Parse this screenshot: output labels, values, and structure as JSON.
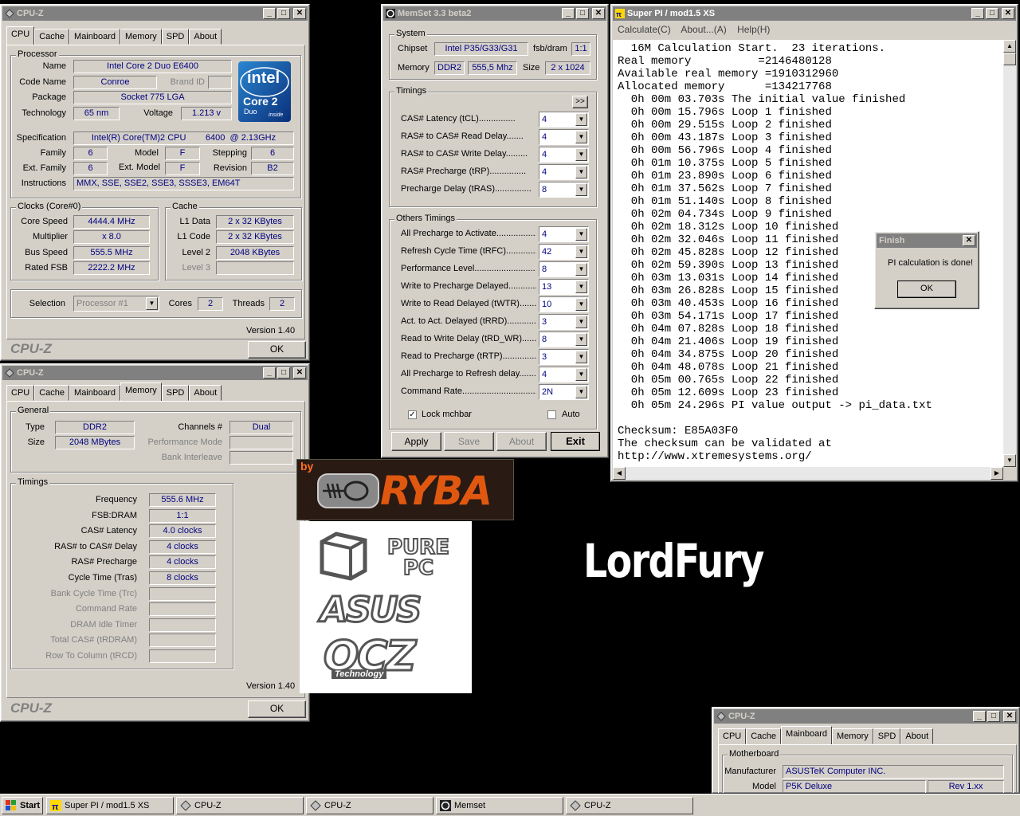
{
  "cpuz1": {
    "title": "CPU-Z",
    "tabs": [
      "CPU",
      "Cache",
      "Mainboard",
      "Memory",
      "SPD",
      "About"
    ],
    "processor_group": "Processor",
    "name_label": "Name",
    "name": "Intel Core 2 Duo E6400",
    "codename_label": "Code Name",
    "codename": "Conroe",
    "brandid_label": "Brand ID",
    "package_label": "Package",
    "package": "Socket 775 LGA",
    "technology_label": "Technology",
    "technology": "65 nm",
    "voltage_label": "Voltage",
    "voltage": "1.213 v",
    "spec_label": "Specification",
    "spec": "Intel(R) Core(TM)2 CPU        6400  @ 2.13GHz",
    "family_label": "Family",
    "family": "6",
    "model_label": "Model",
    "model": "F",
    "stepping_label": "Stepping",
    "stepping": "6",
    "extfamily_label": "Ext. Family",
    "extfamily": "6",
    "extmodel_label": "Ext. Model",
    "extmodel": "F",
    "revision_label": "Revision",
    "revision": "B2",
    "instructions_label": "Instructions",
    "instructions": "MMX, SSE, SSE2, SSE3, SSSE3, EM64T",
    "logo_intel": "intel",
    "logo_core2": "Core 2",
    "logo_duo": "Duo",
    "logo_inside": "inside",
    "clocks_group": "Clocks (Core#0)",
    "corespeed_label": "Core Speed",
    "corespeed": "4444.4 MHz",
    "multiplier_label": "Multiplier",
    "multiplier": "x 8.0",
    "busspeed_label": "Bus Speed",
    "busspeed": "555.5 MHz",
    "ratedfsb_label": "Rated FSB",
    "ratedfsb": "2222.2 MHz",
    "cache_group": "Cache",
    "l1data_label": "L1 Data",
    "l1data": "2 x 32 KBytes",
    "l1code_label": "L1 Code",
    "l1code": "2 x 32 KBytes",
    "level2_label": "Level 2",
    "level2": "2048 KBytes",
    "level3_label": "Level 3",
    "selection_label": "Selection",
    "selection": "Processor #1",
    "cores_label": "Cores",
    "cores": "2",
    "threads_label": "Threads",
    "threads": "2",
    "version": "Version 1.40",
    "brand": "CPU-Z",
    "ok": "OK"
  },
  "cpuz2": {
    "title": "CPU-Z",
    "tabs": [
      "CPU",
      "Cache",
      "Mainboard",
      "Memory",
      "SPD",
      "About"
    ],
    "general_group": "General",
    "type_label": "Type",
    "type": "DDR2",
    "channels_label": "Channels #",
    "channels": "Dual",
    "size_label": "Size",
    "size": "2048 MBytes",
    "perfmode_label": "Performance Mode",
    "bankinter_label": "Bank Interleave",
    "timings_group": "Timings",
    "rows": [
      {
        "label": "Frequency",
        "value": "555.6 MHz",
        "dis": false
      },
      {
        "label": "FSB:DRAM",
        "value": "1:1",
        "dis": false
      },
      {
        "label": "CAS# Latency",
        "value": "4.0 clocks",
        "dis": false
      },
      {
        "label": "RAS# to CAS# Delay",
        "value": "4 clocks",
        "dis": false
      },
      {
        "label": "RAS# Precharge",
        "value": "4 clocks",
        "dis": false
      },
      {
        "label": "Cycle Time (Tras)",
        "value": "8 clocks",
        "dis": false
      },
      {
        "label": "Bank Cycle Time (Trc)",
        "value": "",
        "dis": true
      },
      {
        "label": "Command Rate",
        "value": "",
        "dis": true
      },
      {
        "label": "DRAM Idle Timer",
        "value": "",
        "dis": true
      },
      {
        "label": "Total CAS# (tRDRAM)",
        "value": "",
        "dis": true
      },
      {
        "label": "Row To Column (tRCD)",
        "value": "",
        "dis": true
      }
    ],
    "version": "Version 1.40",
    "brand": "CPU-Z",
    "ok": "OK"
  },
  "memset": {
    "title": "MemSet 3.3 beta2",
    "system_group": "System",
    "chipset_label": "Chipset",
    "chipset": "Intel P35/G33/G31",
    "fsbdram_label": "fsb/dram",
    "fsbdram": "1:1",
    "memory_label": "Memory",
    "memtype": "DDR2",
    "memfreq": "555,5 Mhz",
    "size_label": "Size",
    "size": "2 x 1024",
    "timings_group": "Timings",
    "expand": ">>",
    "timings": [
      {
        "label": "CAS# Latency (tCL)...............",
        "value": "4"
      },
      {
        "label": "RAS# to CAS# Read Delay.......",
        "value": "4"
      },
      {
        "label": "RAS# to CAS# Write Delay.........",
        "value": "4"
      },
      {
        "label": "RAS# Precharge (tRP)...............",
        "value": "4"
      },
      {
        "label": "Precharge Delay  (tRAS)...............",
        "value": "8"
      }
    ],
    "others_group": "Others Timings",
    "others": [
      {
        "label": "All Precharge to Activate..................",
        "value": "4"
      },
      {
        "label": "Refresh Cycle Time (tRFC)...............",
        "value": "42"
      },
      {
        "label": "Performance Level.........................",
        "value": "8"
      },
      {
        "label": "Write to Precharge Delayed.............",
        "value": "13"
      },
      {
        "label": "Write to Read Delayed (tWTR)..........",
        "value": "10"
      },
      {
        "label": "Act. to Act. Delayed (tRRD)..............",
        "value": "3"
      },
      {
        "label": "Read to Write Delay (tRD_WR).......",
        "value": "8"
      },
      {
        "label": "Read to Precharge (tRTP)...............",
        "value": "3"
      },
      {
        "label": "All Precharge to Refresh delay..........",
        "value": "4"
      },
      {
        "label": "Command Rate...............................",
        "value": "2N"
      }
    ],
    "lock_label": "Lock mchbar",
    "auto_label": "Auto",
    "apply": "Apply",
    "save": "Save",
    "about": "About",
    "exit": "Exit"
  },
  "superpi": {
    "title": "Super PI / mod1.5 XS",
    "menu": [
      "Calculate(C)",
      "About...(A)",
      "Help(H)"
    ],
    "lines": [
      "  16M Calculation Start.  23 iterations.",
      "Real memory          =2146480128",
      "Available real memory =1910312960",
      "Allocated memory      =134217768",
      "  0h 00m 03.703s The initial value finished",
      "  0h 00m 15.796s Loop 1 finished",
      "  0h 00m 29.515s Loop 2 finished",
      "  0h 00m 43.187s Loop 3 finished",
      "  0h 00m 56.796s Loop 4 finished",
      "  0h 01m 10.375s Loop 5 finished",
      "  0h 01m 23.890s Loop 6 finished",
      "  0h 01m 37.562s Loop 7 finished",
      "  0h 01m 51.140s Loop 8 finished",
      "  0h 02m 04.734s Loop 9 finished",
      "  0h 02m 18.312s Loop 10 finished",
      "  0h 02m 32.046s Loop 11 finished",
      "  0h 02m 45.828s Loop 12 finished",
      "  0h 02m 59.390s Loop 13 finished",
      "  0h 03m 13.031s Loop 14 finished",
      "  0h 03m 26.828s Loop 15 finished",
      "  0h 03m 40.453s Loop 16 finished",
      "  0h 03m 54.171s Loop 17 finished",
      "  0h 04m 07.828s Loop 18 finished",
      "  0h 04m 21.406s Loop 19 finished",
      "  0h 04m 34.875s Loop 20 finished",
      "  0h 04m 48.078s Loop 21 finished",
      "  0h 05m 00.765s Loop 22 finished",
      "  0h 05m 12.609s Loop 23 finished",
      "  0h 05m 24.296s PI value output -> pi_data.txt",
      "",
      "Checksum: E85A03F0",
      "The checksum can be validated at",
      "http://www.xtremesystems.org/"
    ]
  },
  "finish": {
    "title": "Finish",
    "message": "PI calculation is done!",
    "ok": "OK"
  },
  "cpuz3": {
    "title": "CPU-Z",
    "tabs": [
      "CPU",
      "Cache",
      "Mainboard",
      "Memory",
      "SPD",
      "About"
    ],
    "mobo_group": "Motherboard",
    "manufacturer_label": "Manufacturer",
    "manufacturer": "ASUSTeK Computer INC.",
    "model_label": "Model",
    "model": "P5K Deluxe",
    "rev": "Rev 1.xx"
  },
  "logos": {
    "ryba_by": "by",
    "ryba": "RYBA",
    "purepc": "PURE PC",
    "asus": "ASUS",
    "ocz": "OCZ",
    "ocz_tech": "Technology"
  },
  "overlay_text": "LordFury",
  "taskbar": {
    "start": "Start",
    "items": [
      "Super PI / mod1.5 XS",
      "CPU-Z",
      "CPU-Z",
      "Memset",
      "CPU-Z"
    ]
  }
}
